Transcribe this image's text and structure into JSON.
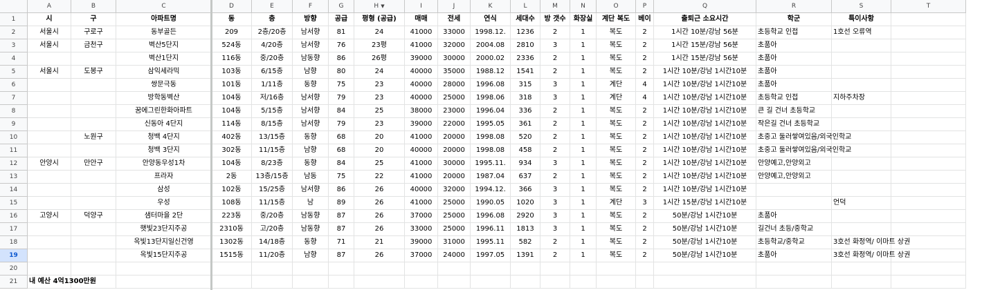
{
  "column_letters": [
    "A",
    "B",
    "C",
    "D",
    "E",
    "F",
    "G",
    "H",
    "I",
    "J",
    "K",
    "L",
    "M",
    "N",
    "O",
    "P",
    "Q",
    "R",
    "S",
    "T"
  ],
  "filter_column": "H",
  "selected_row": 19,
  "headers": [
    "시",
    "구",
    "아파트명",
    "동",
    "층",
    "방향",
    "공급",
    "평형 (공급)",
    "매매",
    "전세",
    "연식",
    "세대수",
    "방 갯수",
    "화장실",
    "계단 복도",
    "베이",
    "출퇴근 소요시간",
    "학군",
    "특이사항",
    ""
  ],
  "rows": [
    [
      "서울시",
      "구로구",
      "동부골든",
      "209",
      "2층/20층",
      "남서향",
      "81",
      "24",
      "41000",
      "33000",
      "1998.12.",
      "1236",
      "2",
      "1",
      "복도",
      "2",
      "1시간 10분/강남 56분",
      "초등학교 인접",
      "1호선 오류역",
      ""
    ],
    [
      "서울시",
      "금천구",
      "벽산5단지",
      "524동",
      "4/20층",
      "남서향",
      "76",
      "23평",
      "41000",
      "32000",
      "2004.08",
      "2810",
      "3",
      "1",
      "복도",
      "2",
      "1시간 15분/강남 56분",
      "초품아",
      "",
      ""
    ],
    [
      "",
      "",
      "벽산1단지",
      "116동",
      "중/20층",
      "남동향",
      "86",
      "26평",
      "39000",
      "30000",
      "2000.02",
      "2336",
      "2",
      "1",
      "복도",
      "2",
      "1시간 15분/강남 56분",
      "초품아",
      "",
      ""
    ],
    [
      "서울시",
      "도봉구",
      "삼익세라믹",
      "103동",
      "6/15층",
      "남향",
      "80",
      "24",
      "40000",
      "35000",
      "1988.12",
      "1541",
      "2",
      "1",
      "복도",
      "2",
      "1시간 10분/강남 1시간10분",
      "초품아",
      "",
      ""
    ],
    [
      "",
      "",
      "쌍문극동",
      "101동",
      "1/11층",
      "동향",
      "75",
      "23",
      "40000",
      "28000",
      "1996.08",
      "315",
      "3",
      "1",
      "계단",
      "4",
      "1시간 10분/강남 1시간10분",
      "초품아",
      "",
      ""
    ],
    [
      "",
      "",
      "방학동벽산",
      "104동",
      "저/16층",
      "남서향",
      "79",
      "23",
      "40000",
      "25000",
      "1998.06",
      "318",
      "3",
      "1",
      "계단",
      "4",
      "1시간 10분/강남 1시간10분",
      "초등학교 인접",
      "지하주차장",
      ""
    ],
    [
      "",
      "",
      "꿈에그린한화아파트",
      "104동",
      "5/15층",
      "남서향",
      "84",
      "25",
      "38000",
      "23000",
      "1996.04",
      "336",
      "2",
      "1",
      "복도",
      "2",
      "1시간 10분/강남 1시간10분",
      "큰 길 건너 초등학교",
      "",
      ""
    ],
    [
      "",
      "",
      "신동아 4단지",
      "114동",
      "8/15층",
      "남서향",
      "79",
      "23",
      "39000",
      "22000",
      "1995.05",
      "361",
      "2",
      "1",
      "복도",
      "2",
      "1시간 10분/강남 1시간10분",
      "작은길 건너 초등학교",
      "",
      ""
    ],
    [
      "",
      "노원구",
      "청백 4단지",
      "402동",
      "13/15층",
      "동향",
      "68",
      "20",
      "41000",
      "20000",
      "1998.08",
      "520",
      "2",
      "1",
      "복도",
      "2",
      "1시간 10분/강남 1시간10분",
      "초중고 둘러쌓여있음/외국인학교",
      "",
      ""
    ],
    [
      "",
      "",
      "청백 3단지",
      "302동",
      "11/15층",
      "남향",
      "68",
      "20",
      "40000",
      "20000",
      "1998.08",
      "458",
      "2",
      "1",
      "복도",
      "2",
      "1시간 10분/강남 1시간10분",
      "초중고 둘러쌓여있음/외국인학교",
      "",
      ""
    ],
    [
      "안양시",
      "만안구",
      "안양동우성1차",
      "104동",
      "8/23층",
      "동향",
      "84",
      "25",
      "41000",
      "30000",
      "1995.11.",
      "934",
      "3",
      "1",
      "복도",
      "2",
      "1시간 10분/강남 1시간10분",
      "안양예고,안양외고",
      "",
      ""
    ],
    [
      "",
      "",
      "프라자",
      "2동",
      "13층/15층",
      "남동",
      "75",
      "22",
      "41000",
      "20000",
      "1987.04",
      "637",
      "2",
      "1",
      "복도",
      "2",
      "1시간 10분/강남 1시간10분",
      "안양예고,안양외고",
      "",
      ""
    ],
    [
      "",
      "",
      "삼성",
      "102동",
      "15/25층",
      "남서향",
      "86",
      "26",
      "40000",
      "32000",
      "1994.12.",
      "366",
      "3",
      "1",
      "복도",
      "2",
      "1시간 10분/강남 1시간10분",
      "",
      "",
      ""
    ],
    [
      "",
      "",
      "우성",
      "108동",
      "11/15층",
      "남",
      "89",
      "26",
      "41000",
      "25000",
      "1990.05",
      "1020",
      "3",
      "1",
      "계단",
      "3",
      "1시간 15분/강남 1시간10분",
      "",
      "언덕",
      ""
    ],
    [
      "고양시",
      "덕양구",
      "샘터마을 2단",
      "223동",
      "중/20층",
      "남동향",
      "87",
      "26",
      "37000",
      "25000",
      "1996.08",
      "2920",
      "3",
      "1",
      "복도",
      "2",
      "50분/강남 1시간10분",
      "초품아",
      "",
      ""
    ],
    [
      "",
      "",
      "햇빛23단지주공",
      "2310동",
      "고/20층",
      "남동향",
      "87",
      "26",
      "33000",
      "25000",
      "1996.11",
      "1813",
      "3",
      "1",
      "복도",
      "2",
      "50분/강남 1시간10분",
      "길건너 초등/중학교",
      "",
      ""
    ],
    [
      "",
      "",
      "옥빛13단지일신건영",
      "1302동",
      "14/18층",
      "동향",
      "71",
      "21",
      "39000",
      "31000",
      "1995.11",
      "582",
      "2",
      "1",
      "복도",
      "2",
      "50분/강남 1시간10분",
      "초등학교/중학교",
      "3호선 화정역/ 이마트 상권",
      ""
    ],
    [
      "",
      "",
      "옥빛15단지주공",
      "1515동",
      "11/20층",
      "남향",
      "87",
      "26",
      "37000",
      "24000",
      "1997.05",
      "1391",
      "2",
      "1",
      "복도",
      "2",
      "50분/강남 1시간10분",
      "초품아",
      "3호선 화정역/ 이마트 상권",
      ""
    ],
    [
      "",
      "",
      "",
      "",
      "",
      "",
      "",
      "",
      "",
      "",
      "",
      "",
      "",
      "",
      "",
      "",
      "",
      "",
      "",
      ""
    ],
    [
      "내 예산 4억1300만원",
      "",
      "",
      "",
      "",
      "",
      "",
      "",
      "",
      "",
      "",
      "",
      "",
      "",
      "",
      "",
      "",
      "",
      "",
      ""
    ]
  ]
}
